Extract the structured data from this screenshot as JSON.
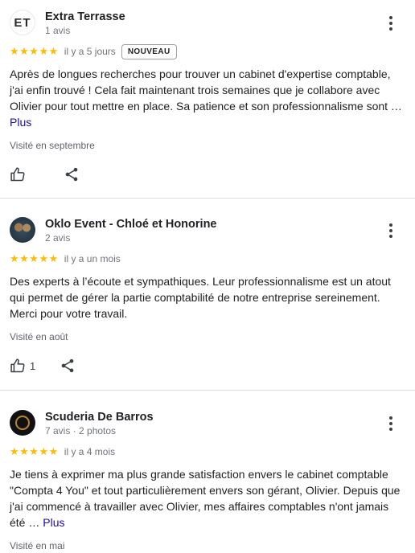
{
  "reviews": [
    {
      "author": "Extra Terrasse",
      "avatar_text": "ET",
      "meta": "1 avis",
      "stars": "★★★★★",
      "rating": 5,
      "when": "il y a 5 jours",
      "badge": "NOUVEAU",
      "text": "Après de longues recherches pour trouver un cabinet d'expertise comptable, j'ai enfin trouvé ! Cela fait maintenant trois semaines que je collabore avec Olivier pour tout mettre en place. Sa patience et son professionnalisme sont …",
      "more": "Plus",
      "visited": "Visité en septembre",
      "likes": ""
    },
    {
      "author": "Oklo Event - Chloé et Honorine",
      "meta": "2 avis",
      "stars": "★★★★★",
      "rating": 5,
      "when": "il y a un mois",
      "text": "Des experts à l’écoute et sympathiques. Leur professionnalisme est un atout qui permet de gérer la partie comptabilité de notre entreprise sereinement. Merci pour votre travail.",
      "visited": "Visité en août",
      "likes": "1"
    },
    {
      "author": "Scuderia De Barros",
      "meta": "7 avis · 2 photos",
      "stars": "★★★★★",
      "rating": 5,
      "when": "il y a 4 mois",
      "text": "Je tiens à exprimer ma plus grande satisfaction envers le cabinet comptable \"Compta 4 You\" et tout particulièrement envers son gérant, Olivier. Depuis que j'ai commencé à travailler avec Olivier, mes affaires comptables n'ont jamais été …",
      "more": "Plus",
      "visited": "Visité en mai"
    }
  ],
  "colors": {
    "star": "#fbbc04",
    "link": "#1a0dab",
    "divider": "#dadce0"
  },
  "icons": {
    "like": "thumbs-up-icon",
    "share": "share-icon",
    "more": "more-vert-icon"
  }
}
